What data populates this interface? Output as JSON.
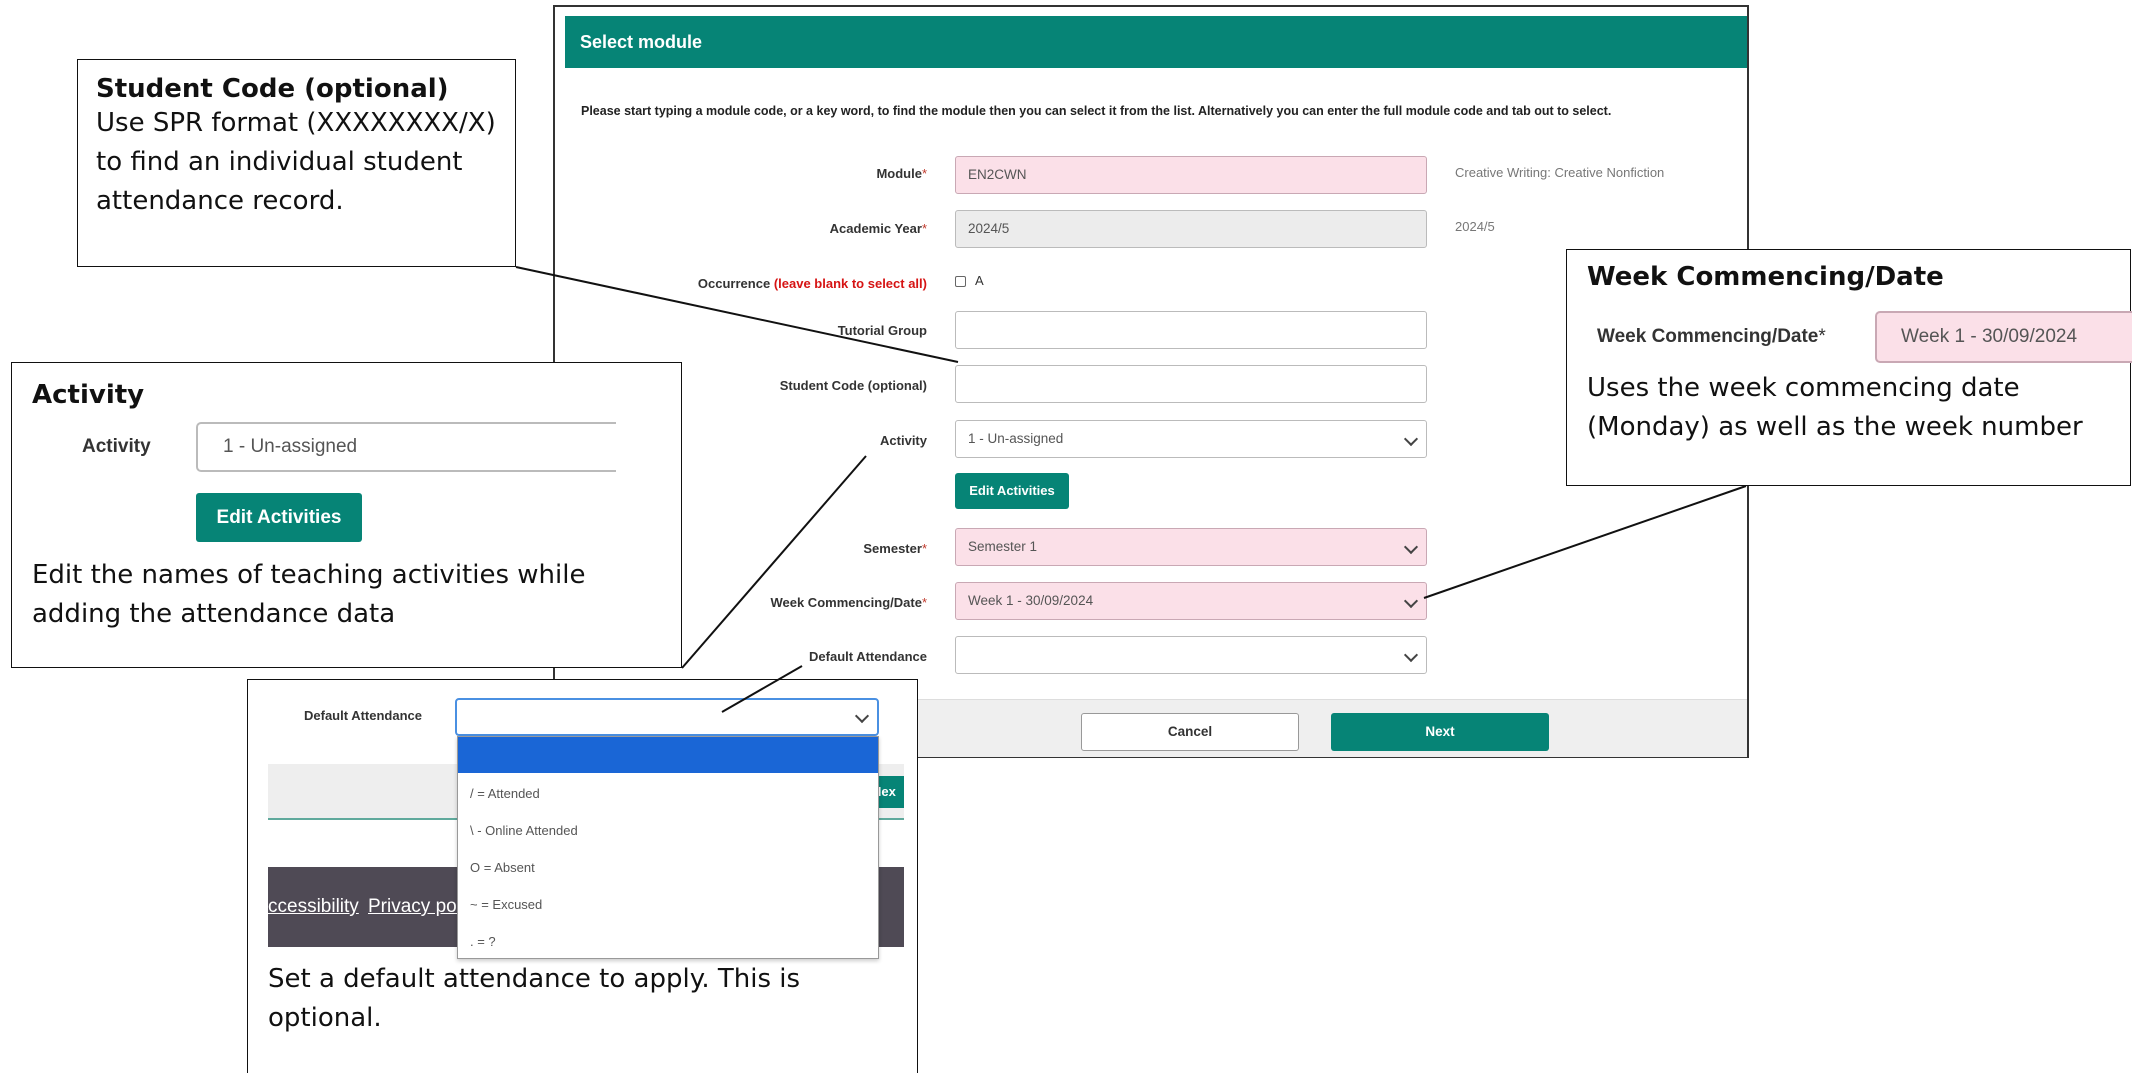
{
  "dialog": {
    "title": "Select module",
    "instructions": "Please start typing a module code, or a key word, to find the module then you can select it from the list. Alternatively you can enter the full module code and tab out to select.",
    "module": {
      "label": "Module",
      "required": "*",
      "value": "EN2CWN",
      "description": "Creative Writing: Creative Nonfiction"
    },
    "academic_year": {
      "label": "Academic Year",
      "required": "*",
      "value": "2024/5",
      "side": "2024/5"
    },
    "occurrence": {
      "label": "Occurrence",
      "hint": "(leave blank to select all)",
      "option": "A",
      "checked": false
    },
    "tutorial_group": {
      "label": "Tutorial Group",
      "value": ""
    },
    "student_code": {
      "label": "Student Code (optional)",
      "value": ""
    },
    "activity": {
      "label": "Activity",
      "value": "1 - Un-assigned"
    },
    "edit_activities": "Edit Activities",
    "semester": {
      "label": "Semester",
      "required": "*",
      "value": "Semester 1"
    },
    "week": {
      "label": "Week Commencing/Date",
      "required": "*",
      "value": "Week 1 - 30/09/2024"
    },
    "default_attendance": {
      "label": "Default Attendance",
      "value": ""
    },
    "cancel": "Cancel",
    "next": "Next"
  },
  "callouts": {
    "student_code": {
      "title": "Student Code (optional)",
      "lines": [
        "Use SPR format (XXXXXXXX/X)",
        "to find an individual student",
        "attendance record."
      ]
    },
    "activity": {
      "title": "Activity",
      "field_label": "Activity",
      "field_value": "1 - Un-assigned",
      "button": "Edit Activities",
      "lines": [
        "Edit the names of teaching activities while",
        "adding the attendance data"
      ]
    },
    "week": {
      "title": "Week Commencing/Date",
      "field_label": "Week Commencing/Date",
      "required": "*",
      "field_value": "Week 1 - 30/09/2024",
      "lines": [
        "Uses the week commencing date",
        "(Monday) as well as the week number"
      ]
    },
    "default_attendance": {
      "field_label": "Default Attendance",
      "options": [
        "",
        "/ = Attended",
        "\\ - Online Attended",
        "O = Absent",
        "~ = Excused",
        ". = ?"
      ],
      "next_partial": "Nex",
      "footer_links": [
        "ccessibility",
        "Privacy poli"
      ],
      "lines": [
        "Set a default attendance to apply. This is",
        "optional."
      ]
    }
  },
  "colors": {
    "teal": "#068476",
    "pink_field": "#fbe0e8",
    "highlight_blue": "#1a66d6",
    "footer_dark": "#4f4a55"
  }
}
